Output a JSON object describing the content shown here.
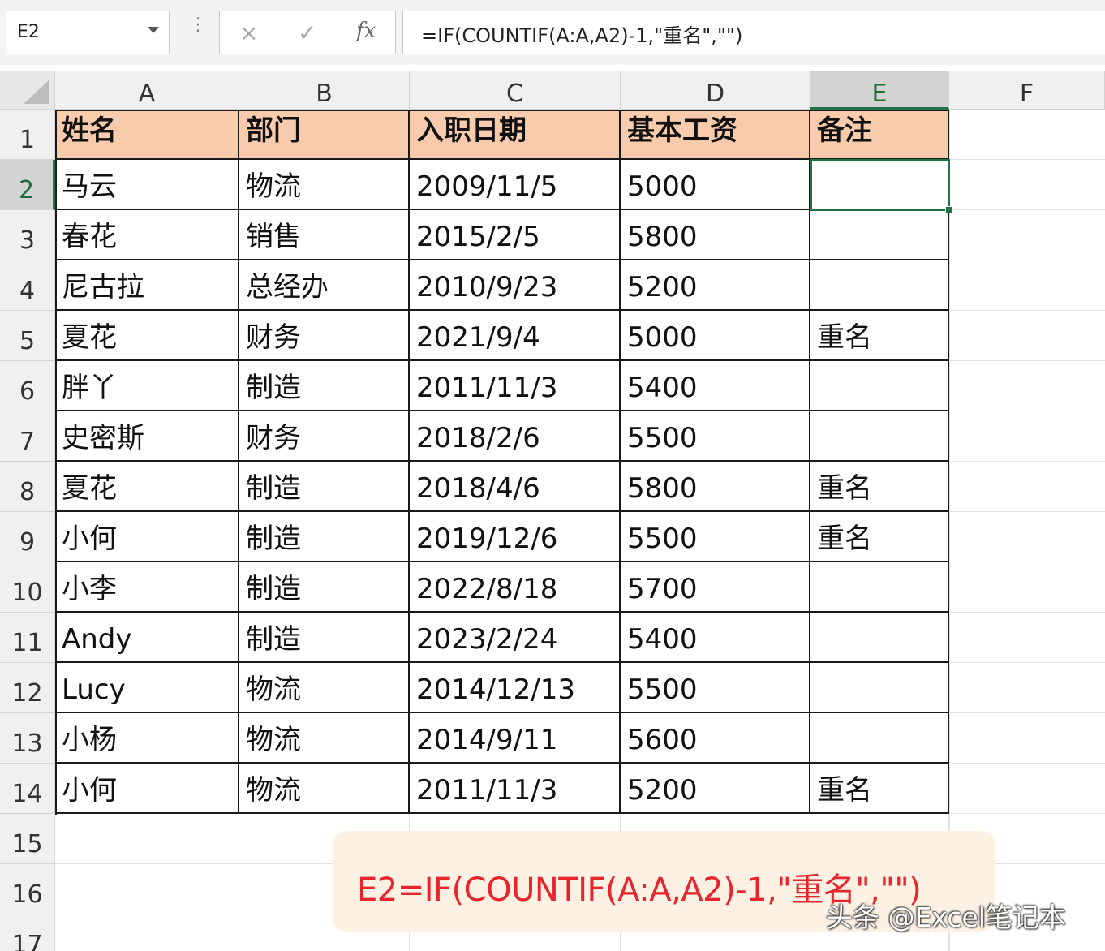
{
  "formula_bar": {
    "name_box": "E2",
    "separator": "⋮",
    "cancel_icon": "×",
    "enter_icon": "✓",
    "fx_icon": "fx",
    "formula": "=IF(COUNTIF(A:A,A2)-1,\"重名\",\"\")"
  },
  "columns": [
    "A",
    "B",
    "C",
    "D",
    "E",
    "F"
  ],
  "rows": [
    "1",
    "2",
    "3",
    "4",
    "5",
    "6",
    "7",
    "8",
    "9",
    "10",
    "11",
    "12",
    "13",
    "14",
    "15",
    "16",
    "17"
  ],
  "selected_cell": "E2",
  "table": {
    "headers": [
      "姓名",
      "部门",
      "入职日期",
      "基本工资",
      "备注"
    ],
    "rows": [
      [
        "马云",
        "物流",
        "2009/11/5",
        "5000",
        ""
      ],
      [
        "春花",
        "销售",
        "2015/2/5",
        "5800",
        ""
      ],
      [
        "尼古拉",
        "总经办",
        "2010/9/23",
        "5200",
        ""
      ],
      [
        "夏花",
        "财务",
        "2021/9/4",
        "5000",
        "重名"
      ],
      [
        "胖丫",
        "制造",
        "2011/11/3",
        "5400",
        ""
      ],
      [
        "史密斯",
        "财务",
        "2018/2/6",
        "5500",
        ""
      ],
      [
        "夏花",
        "制造",
        "2018/4/6",
        "5800",
        "重名"
      ],
      [
        "小何",
        "制造",
        "2019/12/6",
        "5500",
        "重名"
      ],
      [
        "小李",
        "制造",
        "2022/8/18",
        "5700",
        ""
      ],
      [
        "Andy",
        "制造",
        "2023/2/24",
        "5400",
        ""
      ],
      [
        "Lucy",
        "物流",
        "2014/12/13",
        "5500",
        ""
      ],
      [
        "小杨",
        "物流",
        "2014/9/11",
        "5600",
        ""
      ],
      [
        "小何",
        "物流",
        "2011/11/3",
        "5200",
        "重名"
      ]
    ]
  },
  "annotation": {
    "text": "E2=IF(COUNTIF(A:A,A2)-1,\"重名\",\"\")",
    "color": "#e8242c"
  },
  "watermark": "头条 @Excel笔记本",
  "colors": {
    "header_fill": "#f8cbad",
    "selection": "#217346",
    "annotation_bg": "#fdf1e3"
  }
}
